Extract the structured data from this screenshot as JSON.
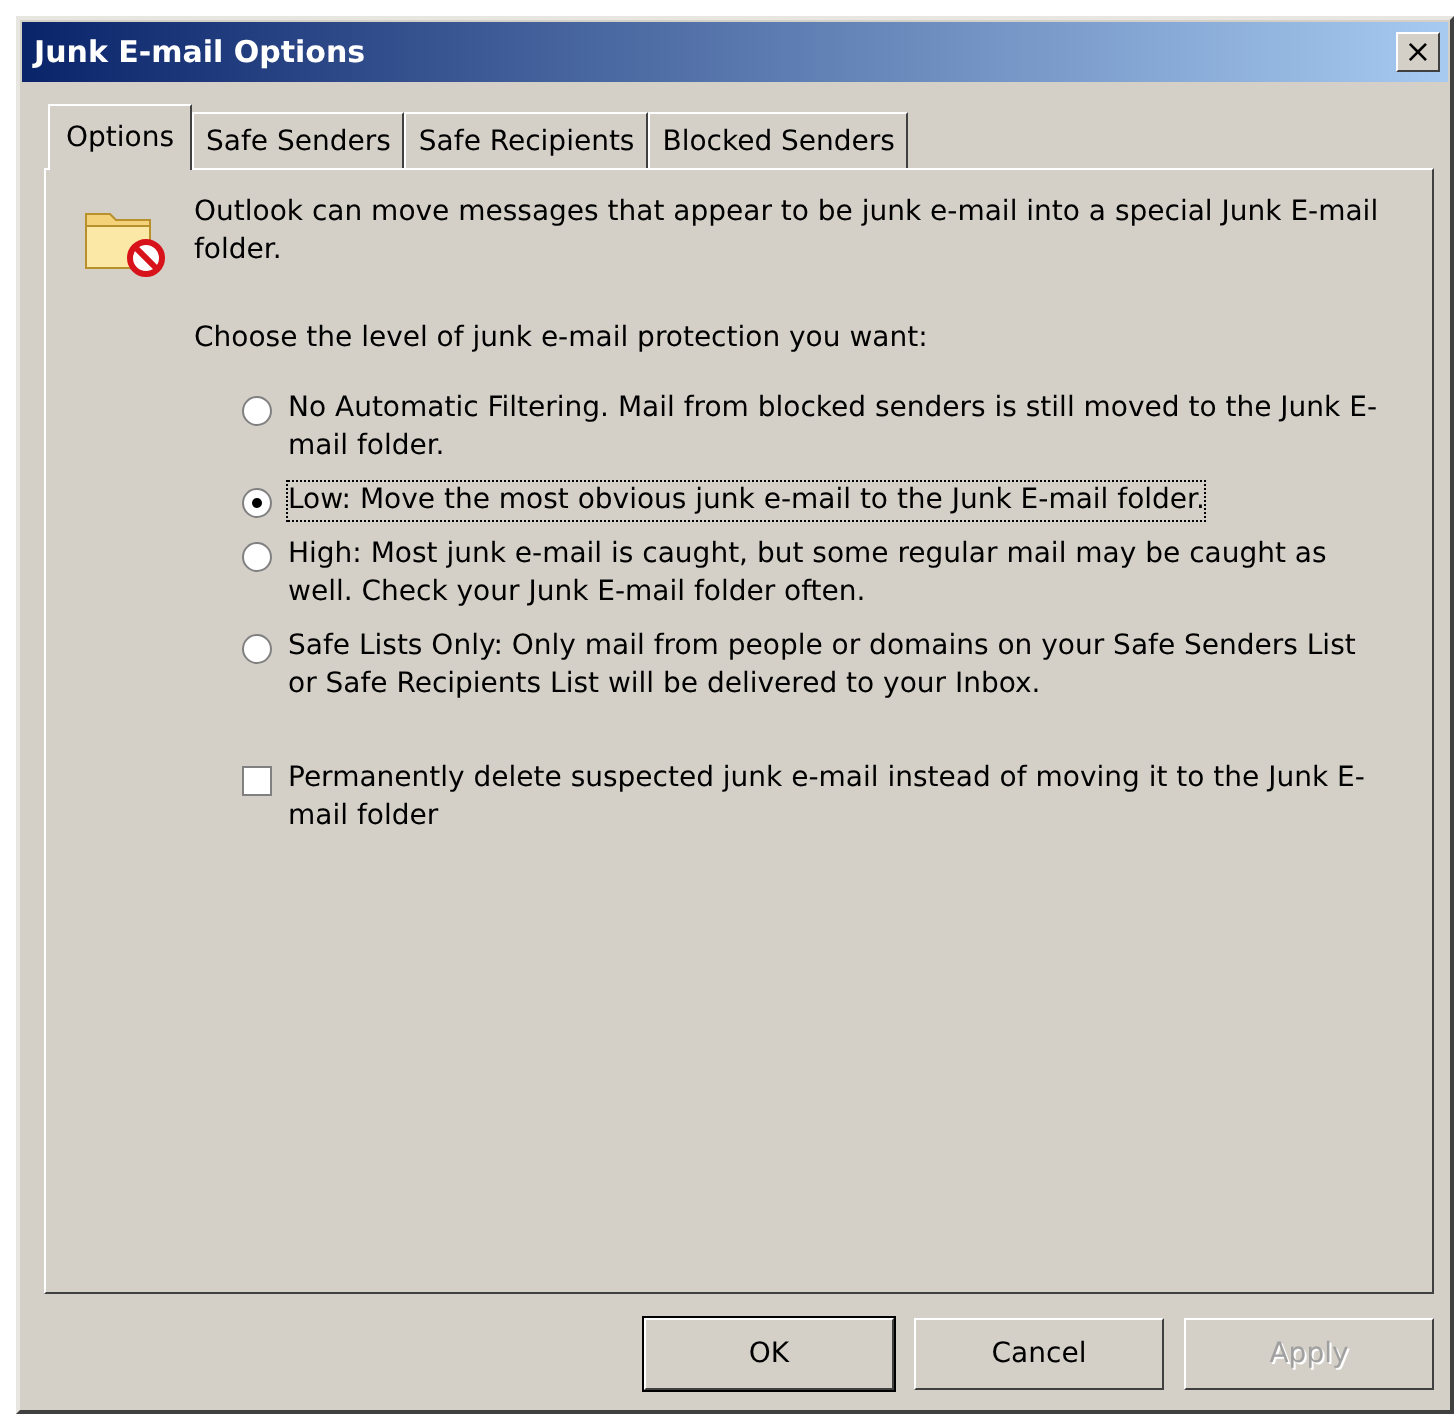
{
  "window": {
    "title": "Junk E-mail Options",
    "close": "×"
  },
  "tabs": [
    {
      "label": "Options",
      "selected": true
    },
    {
      "label": "Safe Senders",
      "selected": false
    },
    {
      "label": "Safe Recipients",
      "selected": false
    },
    {
      "label": "Blocked Senders",
      "selected": false
    }
  ],
  "intro": "Outlook can move messages that appear to be junk e-mail into a special Junk E-mail folder.",
  "prompt": "Choose the level of junk e-mail protection you want:",
  "levels": [
    {
      "label": "No Automatic Filtering.  Mail from blocked senders is still moved to the Junk E-mail folder.",
      "selected": false
    },
    {
      "label": "Low: Move the most obvious junk e-mail to the Junk E-mail folder.",
      "selected": true
    },
    {
      "label": "High: Most junk e-mail is caught, but some regular mail may be caught as well. Check your Junk E-mail folder often.",
      "selected": false
    },
    {
      "label": "Safe Lists Only: Only mail from people or domains on your Safe Senders List or Safe Recipients List will be delivered to your Inbox.",
      "selected": false
    }
  ],
  "delete_option": {
    "label": "Permanently delete suspected junk e-mail instead of moving it to the Junk E-mail folder",
    "checked": false
  },
  "buttons": [
    {
      "label": "OK",
      "default": true,
      "disabled": false
    },
    {
      "label": "Cancel",
      "default": false,
      "disabled": false
    },
    {
      "label": "Apply",
      "default": false,
      "disabled": true
    }
  ]
}
